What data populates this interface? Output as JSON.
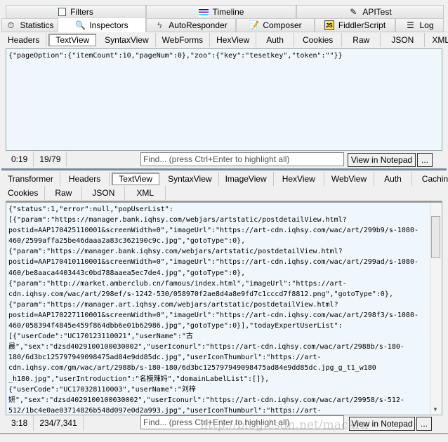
{
  "main_tabs_row1": [
    {
      "label": "Filters",
      "icon": "checkbox-icon"
    },
    {
      "label": "Timeline",
      "icon": "timeline-icon"
    },
    {
      "label": "APITest",
      "icon": "pencil-note-icon"
    }
  ],
  "main_tabs_row2": [
    {
      "label": "Statistics",
      "icon": "stopwatch-icon"
    },
    {
      "label": "Inspectors",
      "icon": "magnifier-icon",
      "selected": true
    },
    {
      "label": "AutoResponder",
      "icon": "lightning-icon"
    },
    {
      "label": "Composer",
      "icon": "compose-icon"
    },
    {
      "label": "FiddlerScript",
      "icon": "script-icon"
    },
    {
      "label": "Log",
      "icon": "log-icon"
    }
  ],
  "request": {
    "tabs": [
      "Headers",
      "TextView",
      "SyntaxView",
      "WebForms",
      "HexView",
      "Auth",
      "Cookies",
      "Raw",
      "JSON",
      "XML"
    ],
    "selected": "TextView",
    "body": "{\"pageOption\":{\"itemCount\":10,\"pageNum\":0},\"zoo\":{\"key\":\"tesetkey\",\"token\":\"\"}}",
    "status": {
      "position": "0:19",
      "count": "19/79"
    },
    "find_placeholder": "Find... (press Ctrl+Enter to highlight all)",
    "notepad_label": "View in Notepad",
    "more_label": "..."
  },
  "response": {
    "tabs_row1": [
      "Transformer",
      "Headers",
      "TextView",
      "SyntaxView",
      "ImageView",
      "HexView",
      "WebView",
      "Auth",
      "Caching"
    ],
    "tabs_row2": [
      "Cookies",
      "Raw",
      "JSON",
      "XML"
    ],
    "selected": "TextView",
    "lines": [
      "{\"status\":1,\"error\":null,\"popUserList\":",
      "[{\"param\":\"https://manager.bank.iqhsy.com/webjars/artstatic/postdetailView.html?",
      "postid=AAP170425110001&screenWidth=0\",\"imageUrl\":\"https://art-cdn.iqhsy.com/wac/art/299b9/s-1080-",
      "460/2599affa25be46daaa2a83c362190c9c.jpg\",\"gotoType\":0},",
      "{\"param\":\"https://manager.bank.iqhsy.com/webjars/artstatic/postdetailView.html?",
      "postid=AAP170410110001&screenWidth=0\",\"imageUrl\":\"https://art-cdn.iqhsy.com/wac/art/299ad/s-1080-",
      "460/be8aaca4403443c0bd788aaea5ec7de4.jpg\",\"gotoType\":0},",
      "{\"param\":\"http://market.amberclub.cn/famous/index.html\",\"imageUrl\":\"https://art-",
      "cdn.iqhsy.com/wac/art/298ef/s-1242-530/058970f2ae8d4a8e9fd7c1cccd7f8812.png\",\"gotoType\":0},",
      "{\"param\":\"https://manager.art.iqhsy.com/webjars/artstatic/postdetailView.html?",
      "postid=AAP170227110001&screenWidth=0\",\"imageUrl\":\"https://art-cdn.iqhsy.com/wac/art/298f3/s-1080-",
      "460/058394f4845e459f864dbb6e01b62986.jpg\",\"gotoType\":0}],\"todayExpertUserList\":",
      "[{\"userCode\":\"UC170123110021\",\"userName\":\"古",
      "晨\",\"sex\":\"dzsd4029100100030002\",\"userIconurl\":\"https://art-cdn.iqhsy.com/wac/art/2988b/s-180-",
      "180/6d3bc125797949098475ad84e9dd85dc.jpg\",\"userIconThumburl\":\"https://art-",
      "cdn.iqhsy.com/gm/wac/art/2988b/s-180-180/6d3bc125797949098475ad84e9dd85dc.jpg_g_t1_w180",
      "_h180.jpg\",\"userIntroduction\":\"名模辣妈\",\"domainLabelList\":[]},",
      "{\"userCode\":\"UC170328110003\",\"userName\":\"刘梓",
      "妍\",\"sex\":\"dzsd4029100100030002\",\"userIconurl\":\"https://art-cdn.iqhsy.com/wac/art/29958/s-512-",
      "512/1bc4e0ae03714826b548d097e0d2a993.jpg\",\"userIconThumburl\":\"https://art-"
    ],
    "status": {
      "position": "3:18",
      "count": "234/7,341"
    },
    "find_placeholder": "Find... (press Ctrl+Enter to highlight all)",
    "notepad_label": "View in Notepad",
    "more_label": "...",
    "watermark": "http://blog.csdn.net/mackrn"
  },
  "colors": {
    "text_bg": "#f0f7fc",
    "panel": "#f0f0f0",
    "divider": "#7a8a9a"
  }
}
